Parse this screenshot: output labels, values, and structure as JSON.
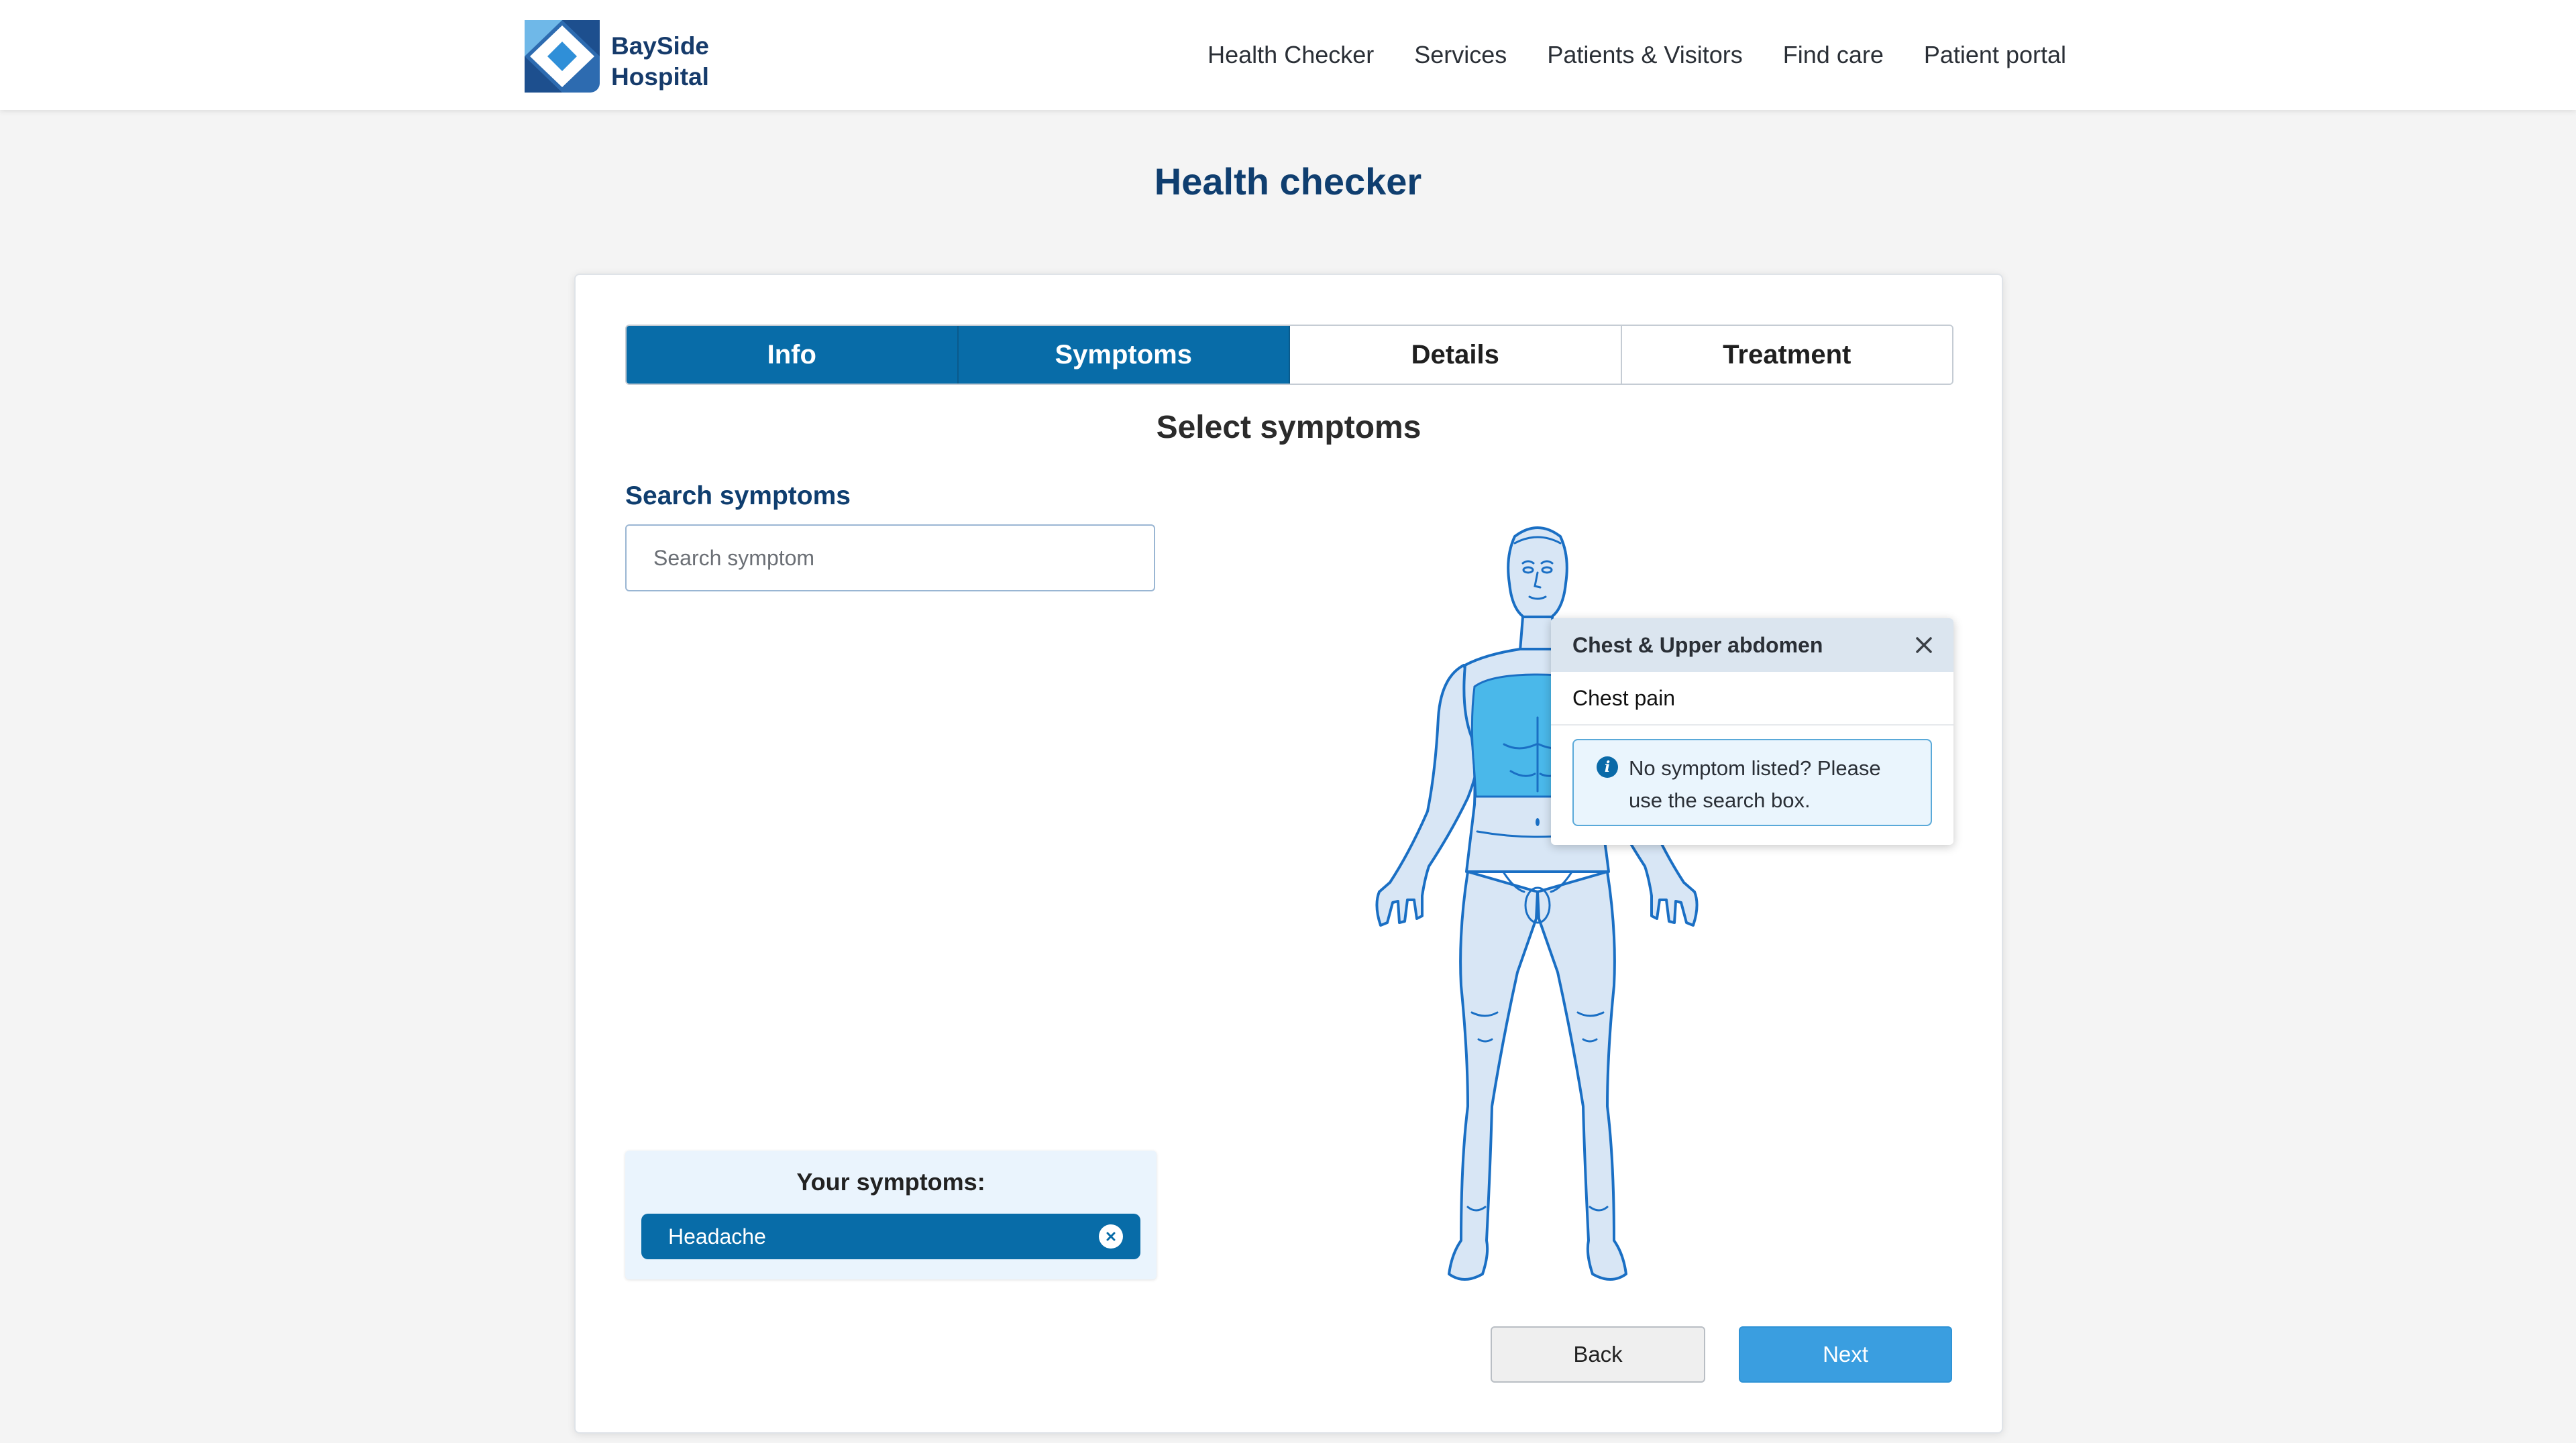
{
  "brand": {
    "name_line1": "BaySide",
    "name_line2": "Hospital"
  },
  "nav": [
    "Health Checker",
    "Services",
    "Patients & Visitors",
    "Find care",
    "Patient portal"
  ],
  "page_title": "Health checker",
  "steps": [
    {
      "label": "Info",
      "state": "done"
    },
    {
      "label": "Symptoms",
      "state": "active"
    },
    {
      "label": "Details",
      "state": "todo"
    },
    {
      "label": "Treatment",
      "state": "todo"
    }
  ],
  "section_title": "Select symptoms",
  "search": {
    "label": "Search symptoms",
    "placeholder": "Search symptom",
    "value": ""
  },
  "your_symptoms": {
    "title": "Your symptoms:",
    "items": [
      "Headache"
    ]
  },
  "body_popup": {
    "region": "Chest & Upper abdomen",
    "items": [
      "Chest pain"
    ],
    "note": "No symptom listed? Please use the search box."
  },
  "buttons": {
    "back": "Back",
    "next": "Next"
  },
  "colors": {
    "primary": "#086ca8",
    "highlight": "#4ab8ea",
    "body_fill": "#d8e6f5",
    "body_outline": "#1a6fc4",
    "next_button": "#3a9ee0"
  }
}
